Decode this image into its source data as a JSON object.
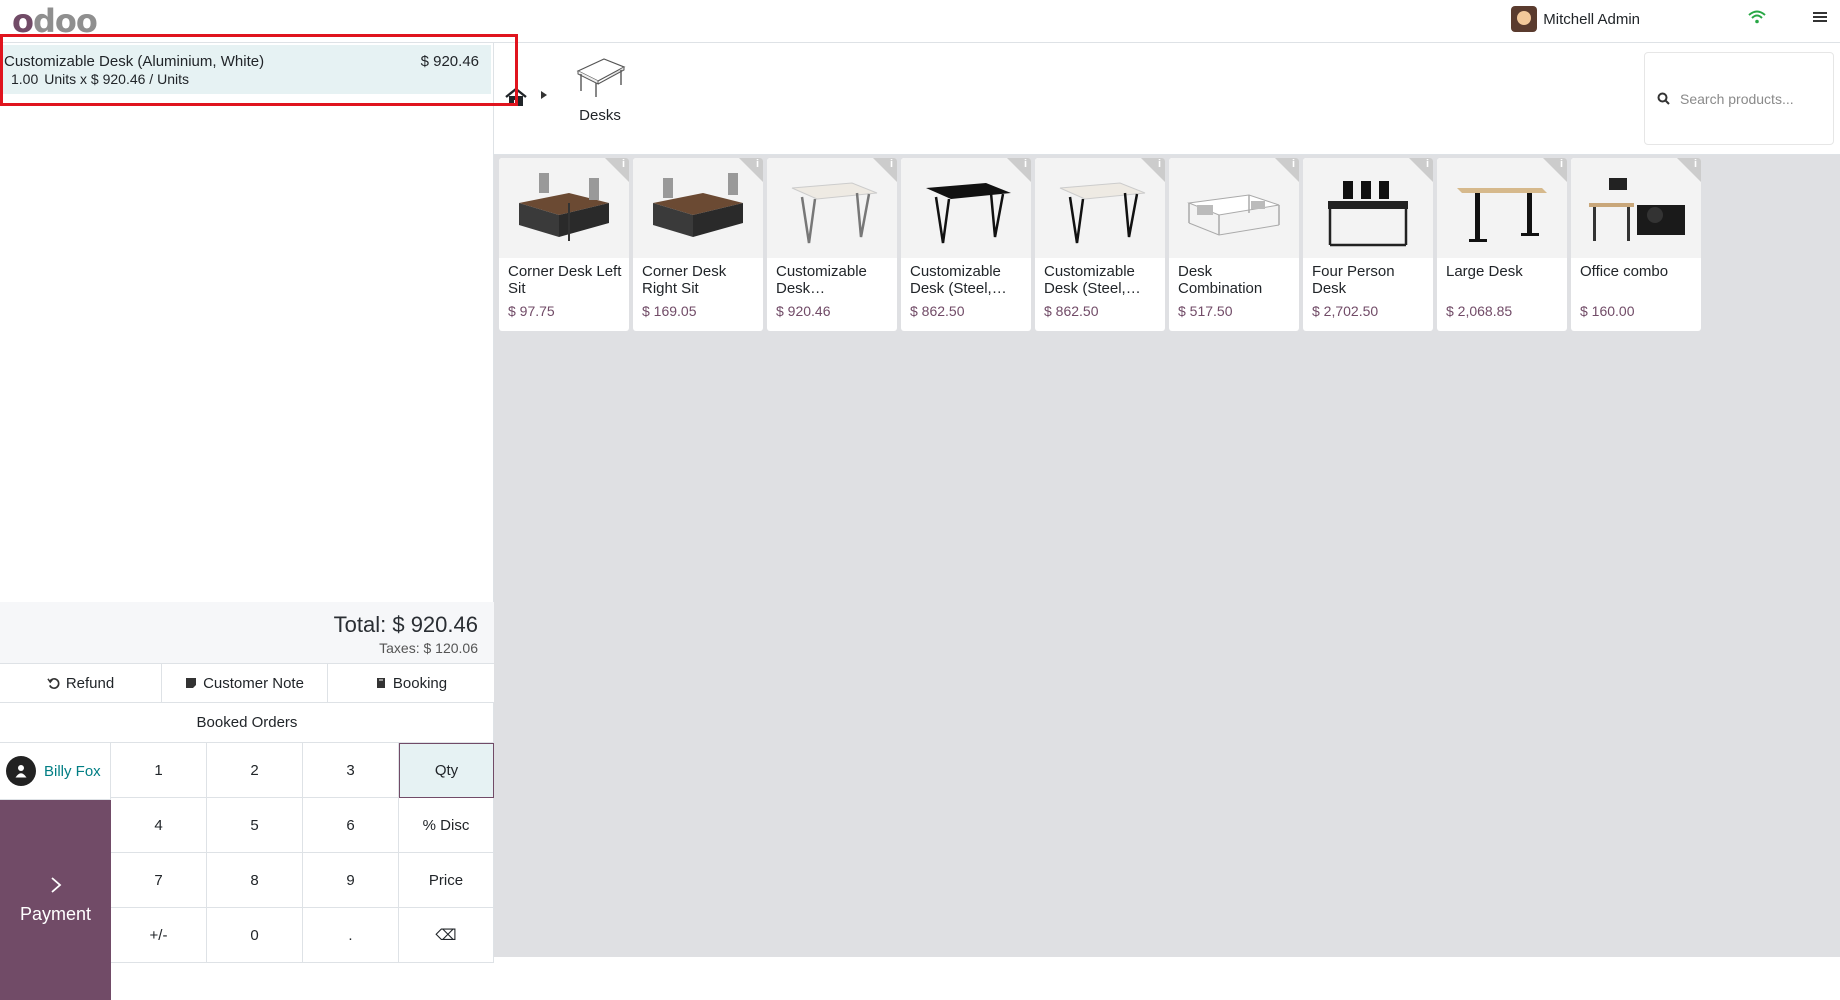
{
  "topbar": {
    "logo": "odoo",
    "user_name": "Mitchell Admin"
  },
  "order": {
    "line": {
      "name": "Customizable Desk (Aluminium, White)",
      "price": "$ 920.46",
      "qty": "1.00",
      "detail": "Units x $ 920.46 / Units"
    },
    "total": "Total: $ 920.46",
    "taxes": "Taxes: $ 120.06"
  },
  "controls": {
    "refund": "Refund",
    "customer_note": "Customer Note",
    "booking": "Booking",
    "booked_orders": "Booked Orders"
  },
  "customer": {
    "name": "Billy Fox"
  },
  "payment": {
    "label": "Payment"
  },
  "numpad": {
    "k1": "1",
    "k2": "2",
    "k3": "3",
    "qty": "Qty",
    "k4": "4",
    "k5": "5",
    "k6": "6",
    "disc": "% Disc",
    "k7": "7",
    "k8": "8",
    "k9": "9",
    "price": "Price",
    "sign": "+/-",
    "k0": "0",
    "dot": ".",
    "back": "⌫"
  },
  "category": {
    "label": "Desks"
  },
  "search": {
    "placeholder": "Search products..."
  },
  "products": [
    {
      "name": "Corner Desk Left Sit",
      "price": "$ 97.75"
    },
    {
      "name": "Corner Desk Right Sit",
      "price": "$ 169.05"
    },
    {
      "name": "Customizable Desk…",
      "price": "$ 920.46"
    },
    {
      "name": "Customizable Desk (Steel,…",
      "price": "$ 862.50"
    },
    {
      "name": "Customizable Desk (Steel,…",
      "price": "$ 862.50"
    },
    {
      "name": "Desk Combination",
      "price": "$ 517.50"
    },
    {
      "name": "Four Person Desk",
      "price": "$ 2,702.50"
    },
    {
      "name": "Large Desk",
      "price": "$ 2,068.85"
    },
    {
      "name": "Office combo",
      "price": "$ 160.00"
    }
  ],
  "colors": {
    "brand": "#714b67",
    "selected_line": "#e6f2f3",
    "highlight_border": "#e0141e",
    "customer": "#017e84"
  }
}
